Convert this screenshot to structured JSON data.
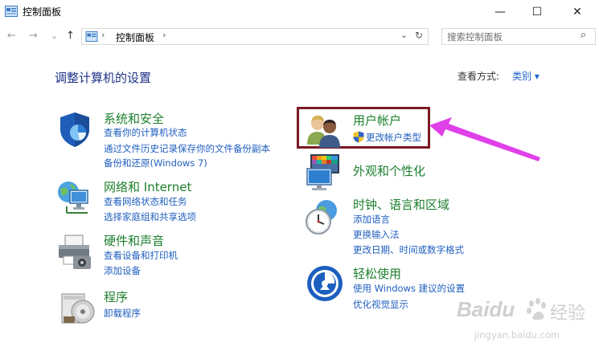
{
  "window": {
    "title": "控制面板",
    "minimize_glyph": "—",
    "maximize_glyph": "☐",
    "close_glyph": "✕"
  },
  "nav": {
    "back_glyph": "←",
    "forward_glyph": "→",
    "recent_glyph": "⌄",
    "up_glyph": "↑",
    "breadcrumb": "控制面板",
    "breadcrumb_sep": "›",
    "dropdown_glyph": "⌄",
    "refresh_glyph": "↻",
    "search_placeholder": "搜索控制面板",
    "search_glyph": "⌕"
  },
  "main": {
    "heading": "调整计算机的设置",
    "view_by_label": "查看方式:",
    "view_by_value": "类别",
    "view_by_arrow": "▾"
  },
  "categories": {
    "security": {
      "title": "系统和安全",
      "links": [
        "查看你的计算机状态",
        "通过文件历史记录保存你的文件备份副本",
        "备份和还原(Windows 7)"
      ],
      "icon": "shield-icon"
    },
    "network": {
      "title": "网络和 Internet",
      "links": [
        "查看网络状态和任务",
        "选择家庭组和共享选项"
      ],
      "icon": "network-globe-icon"
    },
    "hardware": {
      "title": "硬件和声音",
      "links": [
        "查看设备和打印机",
        "添加设备"
      ],
      "icon": "printer-icon"
    },
    "programs": {
      "title": "程序",
      "links": [
        "卸载程序"
      ],
      "icon": "programs-disc-icon"
    },
    "accounts": {
      "title": "用户帐户",
      "links": [
        "更改帐户类型"
      ],
      "icon": "users-icon"
    },
    "appearance": {
      "title": "外观和个性化",
      "links": [],
      "icon": "monitor-palette-icon"
    },
    "clock": {
      "title": "时钟、语言和区域",
      "links": [
        "添加语言",
        "更换输入法",
        "更改日期、时间或数字格式"
      ],
      "icon": "clock-globe-icon"
    },
    "ease": {
      "title": "轻松使用",
      "links": [
        "使用 Windows 建议的设置",
        "优化视觉显示"
      ],
      "icon": "ease-of-access-icon"
    }
  },
  "annotation": {
    "highlight_color": "#7c1a24",
    "arrow_color": "#e040e8"
  },
  "watermark": {
    "brand": "Baidu",
    "cn": "经验",
    "url": "jingyan.baidu.com"
  },
  "colors": {
    "heading": "#1e3287",
    "category_title": "#1d7f2e",
    "link": "#1f5fbf"
  }
}
